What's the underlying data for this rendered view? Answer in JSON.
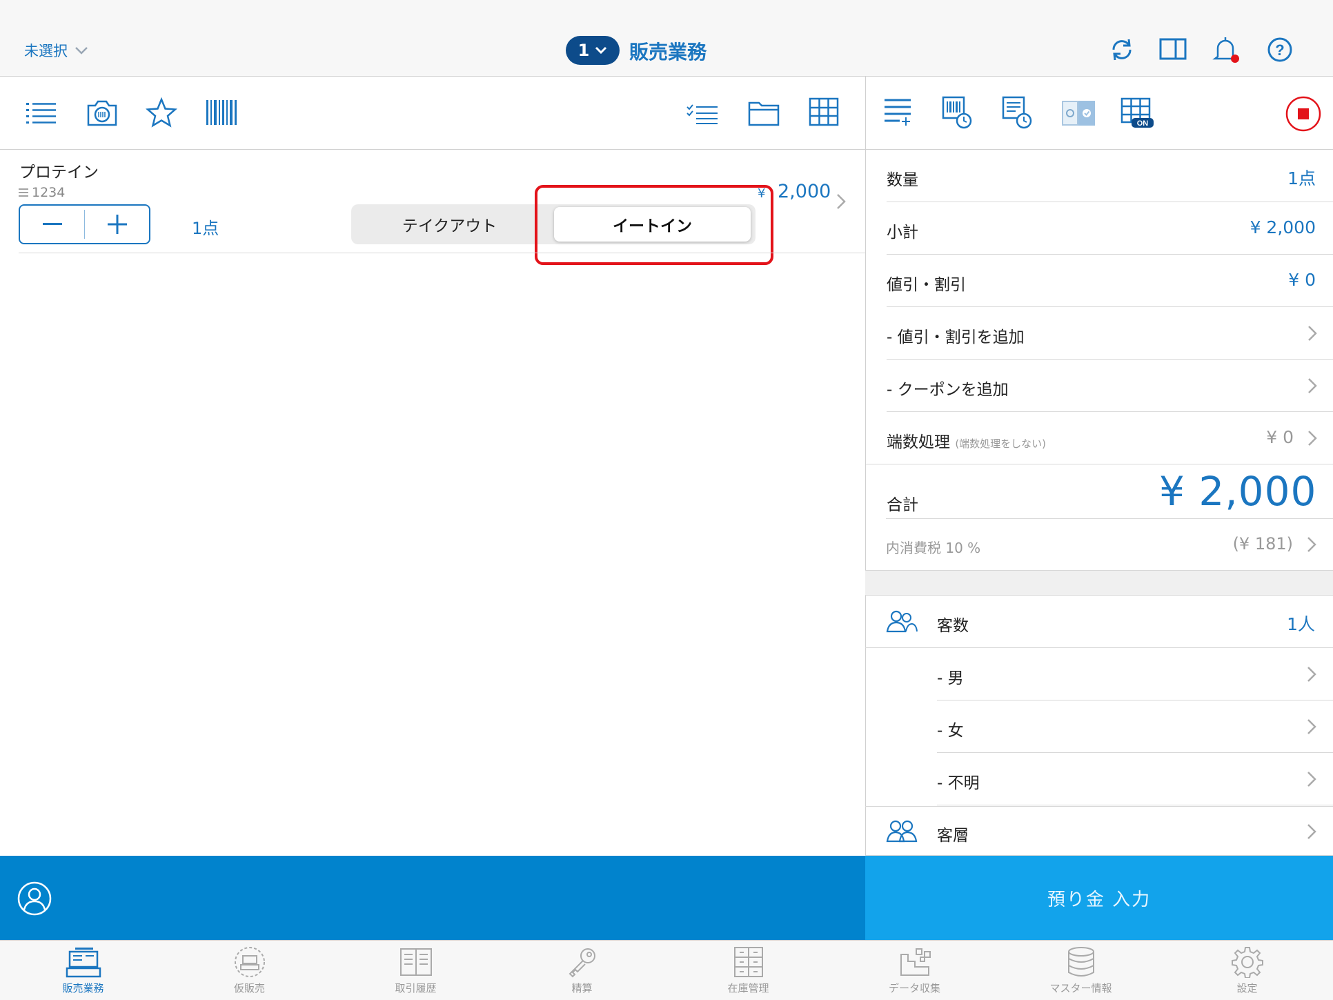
{
  "header": {
    "store_select": "未選択",
    "register_number": "1",
    "title": "販売業務",
    "icons": [
      "sync-icon",
      "split-view-icon",
      "bell-icon",
      "help-icon"
    ]
  },
  "item": {
    "name": "プロテイン",
    "code": "1234",
    "quantity": "1点",
    "price": "2,000",
    "currency": "¥",
    "dine_options": {
      "takeout": "テイクアウト",
      "eatin": "イートイン",
      "selected": "イートイン"
    }
  },
  "summary": {
    "quantity_label": "数量",
    "quantity_value": "1点",
    "subtotal_label": "小計",
    "subtotal_value": "¥ 2,000",
    "discount_label": "値引・割引",
    "discount_value": "¥ 0",
    "add_discount_label": "- 値引・割引を追加",
    "add_coupon_label": "- クーポンを追加",
    "rounding_label": "端数処理",
    "rounding_note": "(端数処理をしない)",
    "rounding_value": "¥ 0",
    "total_label": "合計",
    "total_value": "¥ 2,000",
    "tax_label": "内消費税 10 %",
    "tax_value": "(¥ 181)"
  },
  "customers": {
    "count_label": "客数",
    "count_value": "1人",
    "male_label": "- 男",
    "female_label": "- 女",
    "unknown_label": "- 不明",
    "segment_label": "客層"
  },
  "actions": {
    "deposit_label": "預り金 入力"
  },
  "tabbar": {
    "items": [
      {
        "label": "販売業務",
        "icon": "register-icon",
        "active": true
      },
      {
        "label": "仮販売",
        "icon": "temp-sale-icon",
        "active": false
      },
      {
        "label": "取引履歴",
        "icon": "history-icon",
        "active": false
      },
      {
        "label": "精算",
        "icon": "key-icon",
        "active": false
      },
      {
        "label": "在庫管理",
        "icon": "inventory-icon",
        "active": false
      },
      {
        "label": "データ収集",
        "icon": "data-collection-icon",
        "active": false
      },
      {
        "label": "マスター情報",
        "icon": "database-icon",
        "active": false
      },
      {
        "label": "設定",
        "icon": "gear-icon",
        "active": false
      }
    ]
  },
  "colors": {
    "accent": "#1b76c0",
    "highlight": "#e3131a",
    "action_dark": "#0183cd",
    "action_light": "#12a3eb"
  }
}
